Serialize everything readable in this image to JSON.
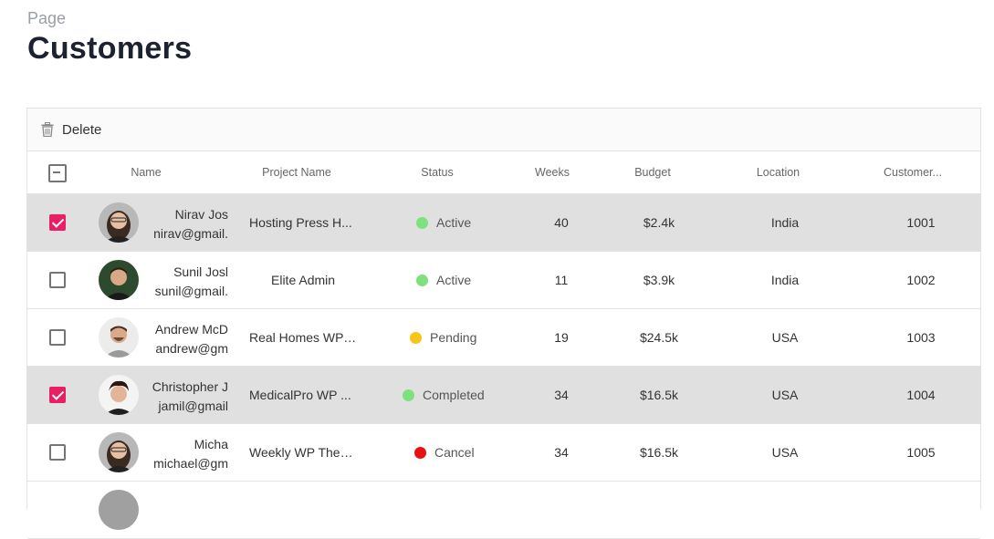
{
  "page": {
    "label": "Page",
    "title": "Customers"
  },
  "toolbar": {
    "delete_label": "Delete"
  },
  "columns": {
    "name": "Name",
    "project": "Project Name",
    "status": "Status",
    "weeks": "Weeks",
    "budget": "Budget",
    "location": "Location",
    "customer": "Customer..."
  },
  "colors": {
    "accent": "#e91e63",
    "active": "#7ee07e",
    "pending": "#f5c518",
    "completed": "#7ee07e",
    "cancel": "#e81010",
    "selected_row": "#e0e0e0"
  },
  "rows": [
    {
      "selected": true,
      "name": "Nirav Jos",
      "email": "nirav@gmail.",
      "project": "Hosting Press H...",
      "status": "Active",
      "status_color": "#7ee07e",
      "weeks": "40",
      "budget": "$2.4k",
      "location": "India",
      "customer": "1001"
    },
    {
      "selected": false,
      "name": "Sunil Josl",
      "email": "sunil@gmail.",
      "project": "Elite Admin",
      "status": "Active",
      "status_color": "#7ee07e",
      "weeks": "11",
      "budget": "$3.9k",
      "location": "India",
      "customer": "1002"
    },
    {
      "selected": false,
      "name": "Andrew McD",
      "email": "andrew@gm",
      "project": "Real Homes WP ...",
      "status": "Pending",
      "status_color": "#f5c518",
      "weeks": "19",
      "budget": "$24.5k",
      "location": "USA",
      "customer": "1003"
    },
    {
      "selected": true,
      "name": "Christopher J",
      "email": "jamil@gmail",
      "project": "MedicalPro WP ...",
      "status": "Completed",
      "status_color": "#7ee07e",
      "weeks": "34",
      "budget": "$16.5k",
      "location": "USA",
      "customer": "1004"
    },
    {
      "selected": false,
      "name": "Micha",
      "email": "michael@gm",
      "project": "Weekly WP Theme",
      "status": "Cancel",
      "status_color": "#e81010",
      "weeks": "34",
      "budget": "$16.5k",
      "location": "USA",
      "customer": "1005"
    }
  ]
}
